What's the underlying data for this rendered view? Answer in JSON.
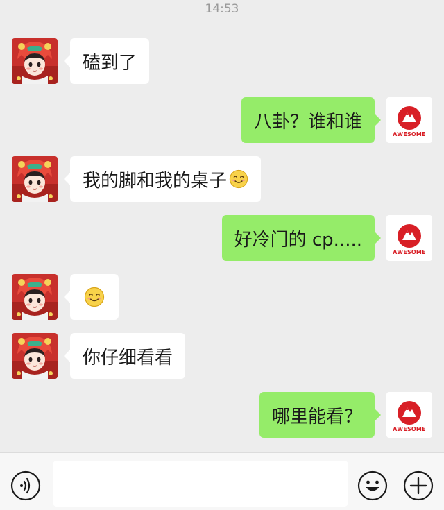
{
  "status": {
    "time": "14:53"
  },
  "contacts": {
    "friend": {
      "avatar": "cartoon-girl-lion-hat-avatar"
    },
    "me": {
      "avatar": "awesome-logo-avatar",
      "brand_text": "AWESOME"
    }
  },
  "messages": [
    {
      "side": "left",
      "text": "磕到了"
    },
    {
      "side": "right",
      "text": "八卦？谁和谁"
    },
    {
      "side": "left",
      "text": "我的脚和我的桌子",
      "emoji": "smiling-face"
    },
    {
      "side": "right",
      "text": "好冷门的 cp....."
    },
    {
      "side": "left",
      "text": "",
      "emoji": "smiling-face"
    },
    {
      "side": "left",
      "text": "你仔细看看"
    },
    {
      "side": "right",
      "text": "哪里能看？"
    }
  ],
  "input_bar": {
    "input_value": "",
    "voice_icon": "voice-icon",
    "emoji_icon": "emoji-face-icon",
    "plus_icon": "plus-circle-icon"
  },
  "colors": {
    "background": "#ededed",
    "sent_bubble": "#95ec69",
    "received_bubble": "#ffffff",
    "brand_red": "#d81f26"
  }
}
